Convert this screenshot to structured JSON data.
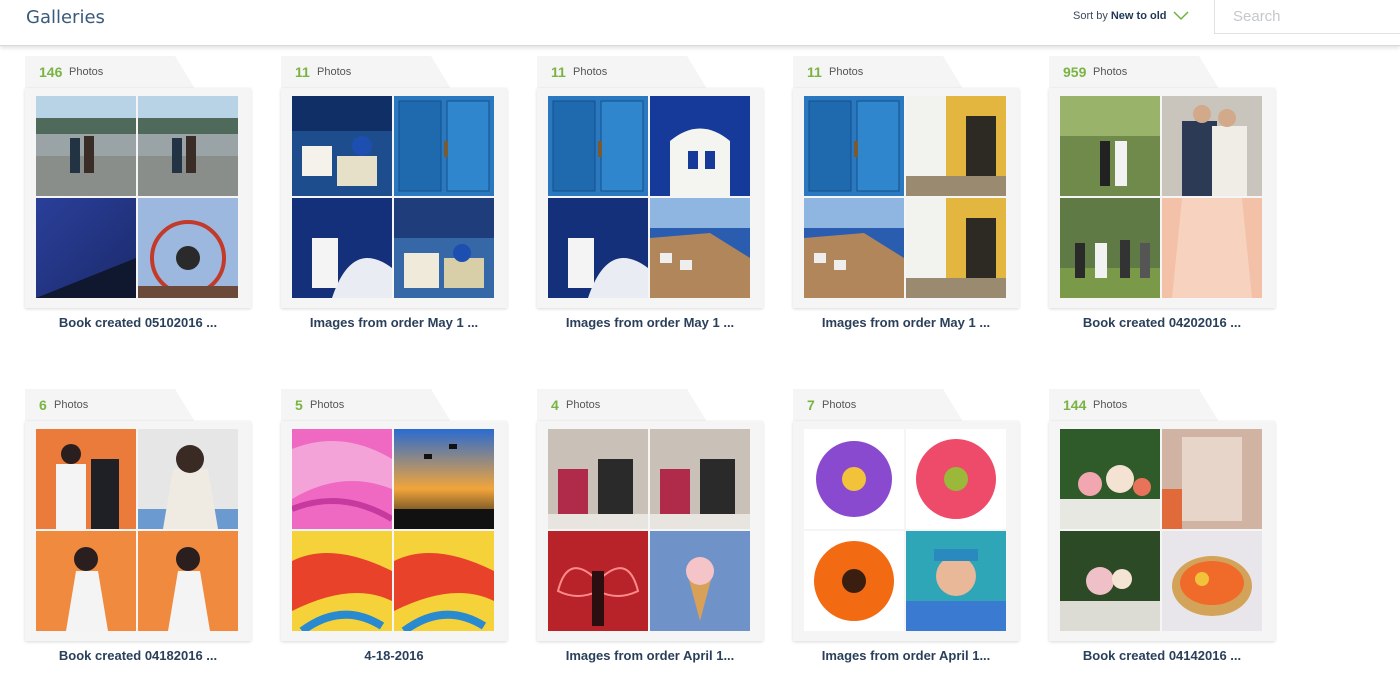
{
  "header": {
    "title": "Galleries",
    "sort_prefix": "Sort by",
    "sort_value": "New to old",
    "search_placeholder": "Search"
  },
  "photos_label": "Photos",
  "galleries": [
    {
      "count": "146",
      "caption": "Book created 05102016  ...",
      "thumbs": [
        "family-at-plaza-photo",
        "family-at-plaza-photo",
        "blue-sky-photo",
        "ferris-wheel-photo"
      ]
    },
    {
      "count": "11",
      "caption": "Images from order May 1 ...",
      "thumbs": [
        "santorini-village-photo",
        "blue-door-photo",
        "white-chapel-photo",
        "santorini-domes-photo"
      ]
    },
    {
      "count": "11",
      "caption": "Images from order May 1 ...",
      "thumbs": [
        "blue-door-photo",
        "bell-tower-photo",
        "white-chapel-photo",
        "cliff-town-photo"
      ]
    },
    {
      "count": "11",
      "caption": "Images from order May 1 ...",
      "thumbs": [
        "blue-door-photo",
        "yellow-alley-photo",
        "cliff-town-photo",
        "yellow-alley-photo"
      ]
    },
    {
      "count": "959",
      "caption": "Book created 04202016  ...",
      "thumbs": [
        "wedding-garden-photo",
        "bride-groom-photo",
        "wedding-guests-photo",
        "lace-dress-photo"
      ]
    },
    {
      "count": "6",
      "caption": "Book created 04182016  ...",
      "thumbs": [
        "couple-orange-photo",
        "bride-smiling-photo",
        "bride-orange-photo",
        "bride-orange-photo"
      ]
    },
    {
      "count": "5",
      "caption": "4-18-2016",
      "thumbs": [
        "pink-paint-photo",
        "graduation-sunset-photo",
        "colorful-paint-photo",
        "colorful-paint-photo"
      ]
    },
    {
      "count": "4",
      "caption": "Images from order April 1...",
      "thumbs": [
        "kitchen-kids-photo",
        "kitchen-kids-photo",
        "neon-wings-photo",
        "ice-cream-photo"
      ]
    },
    {
      "count": "7",
      "caption": "Images from order April 1...",
      "thumbs": [
        "purple-flower-photo",
        "pink-flower-photo",
        "orange-flower-photo",
        "girl-ice-cream-photo"
      ]
    },
    {
      "count": "144",
      "caption": "Book created 04142016  ...",
      "thumbs": [
        "floral-table-photo",
        "menu-card-photo",
        "floral-arrangement-photo",
        "fruit-tart-photo"
      ]
    }
  ]
}
